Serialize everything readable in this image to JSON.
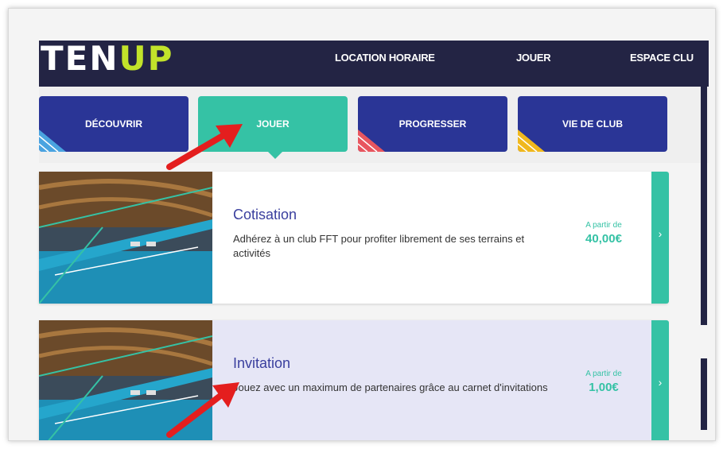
{
  "header": {
    "logo_left": "TEN",
    "logo_right": "UP",
    "nav": [
      "LOCATION HORAIRE",
      "JOUER",
      "ESPACE CLU"
    ]
  },
  "tabs": [
    {
      "label": "DÉCOUVRIR",
      "corner_color": "#4aa3e0"
    },
    {
      "label": "JOUER",
      "active": true
    },
    {
      "label": "PROGRESSER",
      "corner_color": "#e8565f"
    },
    {
      "label": "VIE DE CLUB",
      "corner_color": "#f0b81d"
    }
  ],
  "cards": [
    {
      "title": "Cotisation",
      "description": "Adhérez à un club FFT pour profiter librement de ses terrains et activités",
      "price_label": "A partir de",
      "price": "40,00€"
    },
    {
      "title": "Invitation",
      "description": "Jouez avec un maximum de partenaires grâce au carnet d'invitations",
      "price_label": "A partir de",
      "price": "1,00€"
    }
  ],
  "icons": {
    "card_arrow": "chevron-right-icon",
    "annotation": "red-arrow-icon"
  },
  "colors": {
    "header_bg": "#232444",
    "tab_bg": "#2a3596",
    "accent": "#35c2a5",
    "logo_green": "#c2e32a",
    "title_color": "#3a3f9e",
    "annotation_red": "#e41e1e"
  }
}
